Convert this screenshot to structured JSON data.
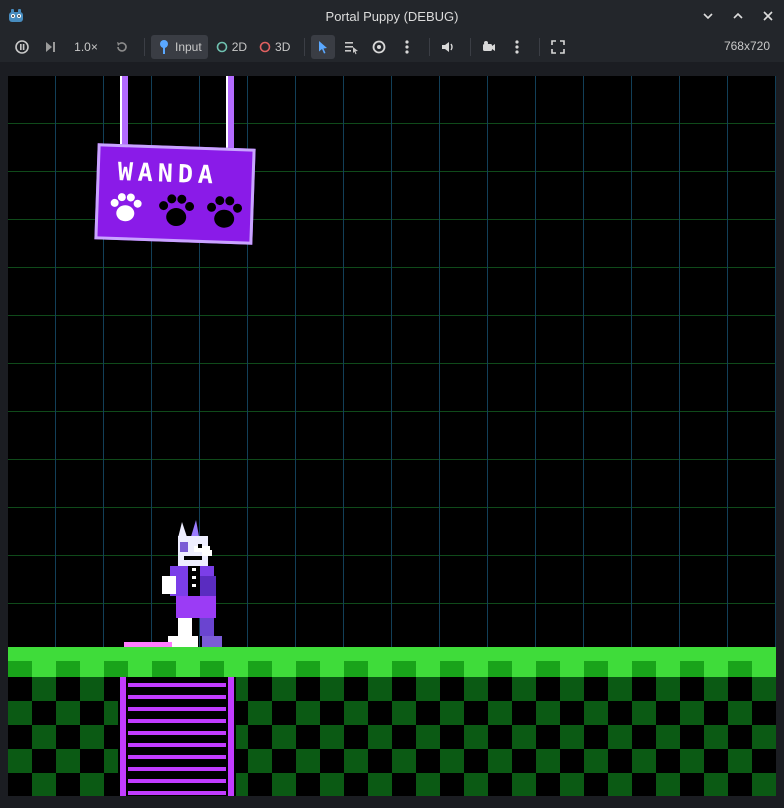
{
  "window": {
    "title": "Portal Puppy (DEBUG)"
  },
  "toolbar": {
    "speed": "1.0×",
    "input_label": "Input",
    "mode_2d": "2D",
    "mode_3d": "3D",
    "resolution": "768x720"
  },
  "icons": {
    "app": "godot-icon",
    "pause": "pause-play-icon",
    "step": "step-frame-icon",
    "reset": "reset-speed-icon",
    "select": "select-cursor-icon",
    "list": "list-select-icon",
    "eye": "visibility-icon",
    "audio": "speaker-icon",
    "camera": "camera-icon",
    "fullscreen": "fullscreen-icon"
  },
  "game": {
    "sign_text": "WANDA",
    "colors": {
      "grid_vertical": "#123f58",
      "grid_horizontal": "#0f4a1a",
      "ground": "#3fdc3a",
      "sign": "#8a1be8",
      "ladder": "#c23cff"
    }
  }
}
